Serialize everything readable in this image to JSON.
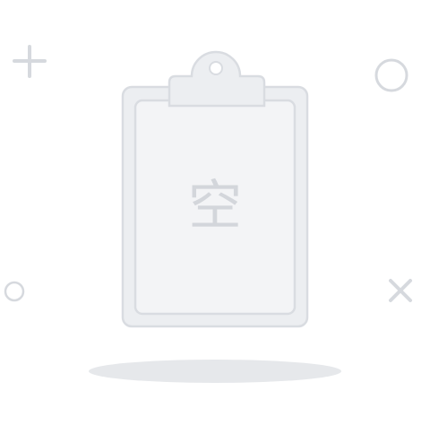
{
  "empty_state": {
    "label": "空"
  },
  "icons": {
    "clipboard": "clipboard-icon",
    "plus": "plus-icon",
    "circle_large": "circle-icon",
    "circle_small": "circle-icon",
    "cross": "close-icon",
    "shadow": "shadow"
  },
  "colors": {
    "stroke": "#d9dce1",
    "fill": "#eceef1",
    "inner_fill": "#f3f4f6",
    "shadow": "#e6e8eb",
    "decor": "#d6d9de",
    "text": "#d3d6db"
  }
}
